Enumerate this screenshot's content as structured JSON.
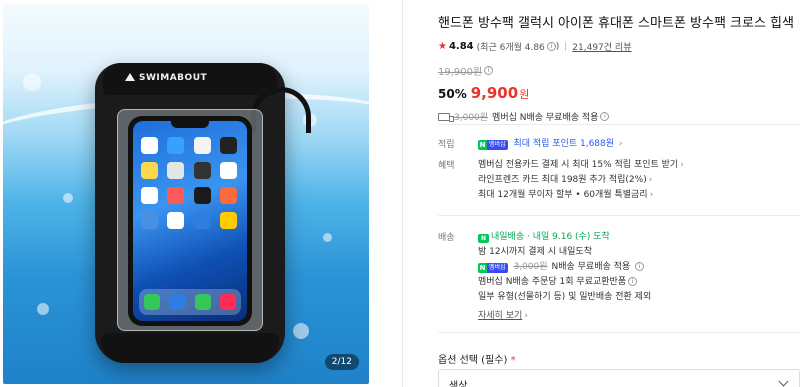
{
  "gallery": {
    "brand": "SWIMABOUT",
    "pager": "2/12"
  },
  "product": {
    "title": "핸드폰 방수팩 갤럭시 아이폰 휴대폰 스마트폰 방수팩 크로스 힙색",
    "rating": "4.84",
    "rating_note": "(최근 6개월 4.86",
    "rating_note_end": ")",
    "reviews": "21,497건 리뷰",
    "original_price": "19,900원",
    "discount": "50%",
    "price": "9,900",
    "price_unit": "원",
    "shipping_strike": "3,000원",
    "shipping_text": "멤버십 N배송 무료배송 적용"
  },
  "benefits": {
    "points_label": "적립",
    "points_text": "최대 적립 포인트 1,688원",
    "perks_label": "혜택",
    "perks": [
      "멤버십 전용카드 결제 시 최대 15% 적립 포인트 받기",
      "라인프렌즈 카드 최대 198원 추가 적립(2%)",
      "최대 12개월 무이자 할부 • 60개월 특별금리"
    ]
  },
  "delivery": {
    "label": "배송",
    "badge": "내일배송",
    "arrival": "내일 9.16 (수) 도착",
    "cutoff": "밤 12시까지 결제 시 내일도착",
    "free_strike": "3,000원",
    "free_text": "N배송 무료배송 적용",
    "exchange": "멤버십 N배송 주문당 1회 무료교환반품",
    "exclude": "일부 유형(선물하기 등) 및 일반배송 전환 제외",
    "details_link": "자세히 보기"
  },
  "options": {
    "label": "옵션 선택 (필수)",
    "required_mark": "*",
    "select_value": "색상"
  },
  "colors": {
    "accent_red": "#e8322b",
    "npay_green": "#03c75a",
    "membership_blue": "#3b4cf0",
    "link_blue": "#2b57e6"
  }
}
